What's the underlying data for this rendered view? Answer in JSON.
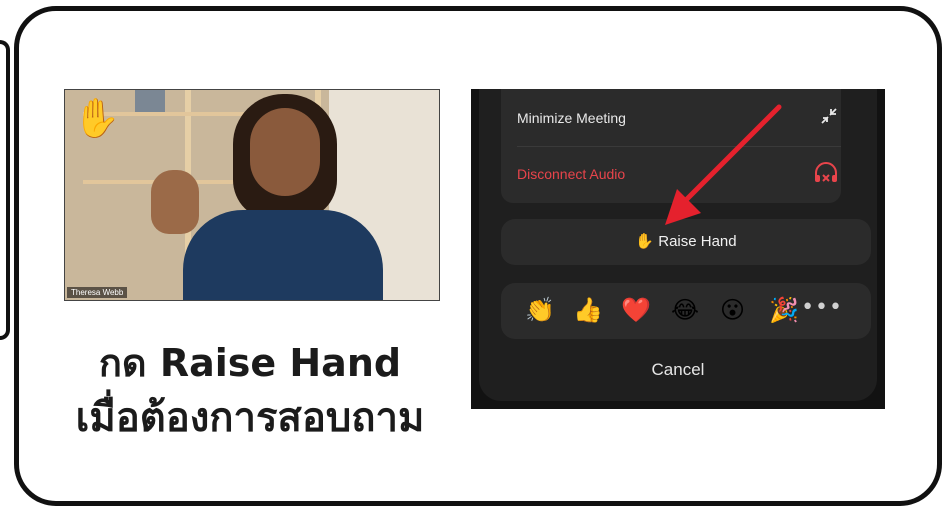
{
  "video": {
    "participant_name": "Theresa Webb",
    "hand_badge_icon": "raised-hand-emoji",
    "hand_emoji": "✋"
  },
  "caption": {
    "line1": "กด Raise Hand",
    "line2": "เมื่อต้องการสอบถาม"
  },
  "menu": {
    "minimize_meeting": "Minimize Meeting",
    "minimize_icon": "↙",
    "disconnect_audio": "Disconnect Audio",
    "disconnect_icon": "🎧",
    "disconnect_color": "#e8444b",
    "raise_hand_emoji": "✋",
    "raise_hand_label": "Raise Hand",
    "reactions": [
      "👏",
      "👍",
      "❤️",
      "😂",
      "😮",
      "🎉"
    ],
    "more_label": "•••",
    "cancel": "Cancel"
  },
  "colors": {
    "arrow": "#e5212d",
    "sheet_bg": "#1f1f1f",
    "row_bg": "#2b2b2b"
  }
}
